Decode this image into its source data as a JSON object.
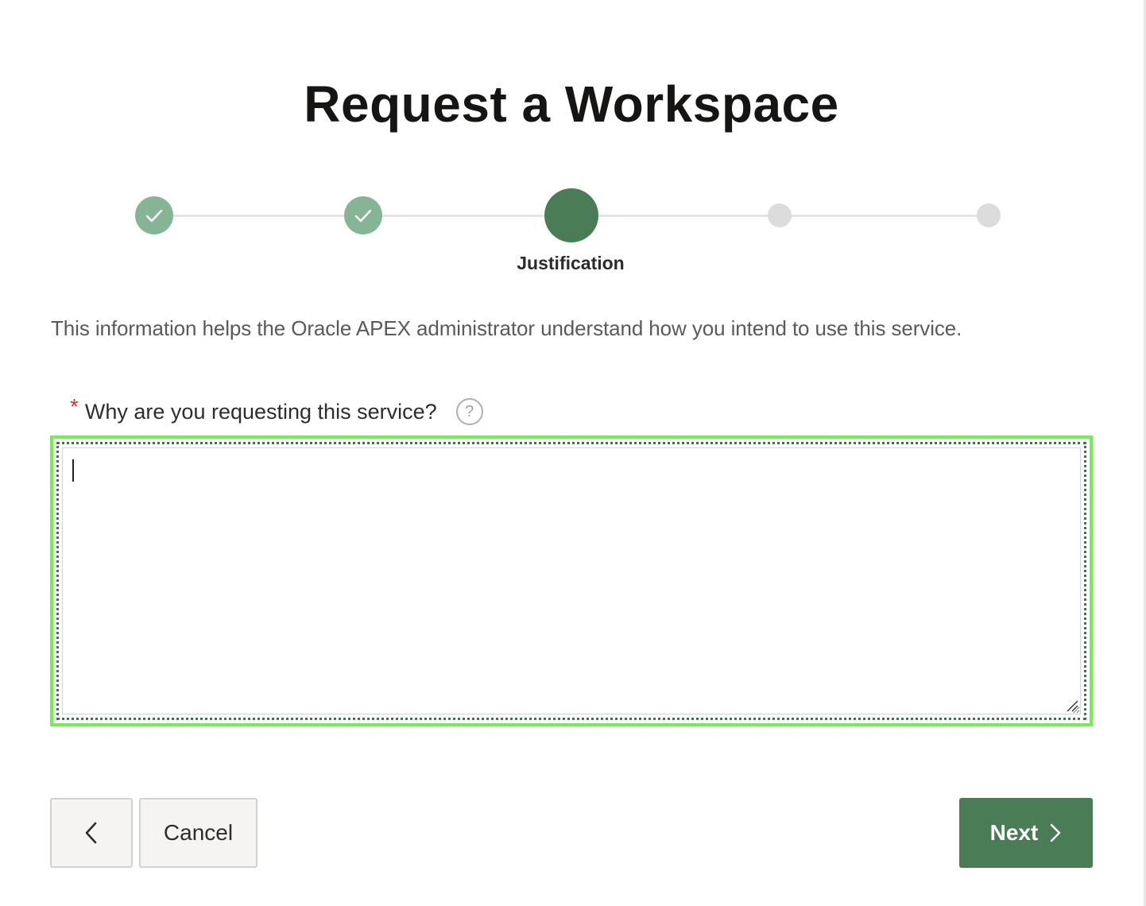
{
  "page": {
    "title": "Request a Workspace"
  },
  "wizard": {
    "steps": [
      {
        "status": "complete",
        "icon": "check-icon"
      },
      {
        "status": "complete",
        "icon": "check-icon"
      },
      {
        "status": "current",
        "label": "Justification"
      },
      {
        "status": "upcoming"
      },
      {
        "status": "upcoming"
      }
    ],
    "current_label": "Justification"
  },
  "info_text": "This information helps the Oracle APEX administrator understand how you intend to use this service.",
  "form": {
    "required_marker": "*",
    "question_label": "Why are you requesting this service?",
    "help_icon": "?",
    "answer_value": ""
  },
  "buttons": {
    "previous_icon": "chevron-left-icon",
    "cancel_label": "Cancel",
    "next_label": "Next",
    "next_icon": "chevron-right-icon"
  },
  "colors": {
    "accent": "#4a7d56",
    "step_complete": "#86b596",
    "step_upcoming": "#dcdcdc",
    "focus_ring": "#72f04f",
    "required": "#c7402d"
  }
}
